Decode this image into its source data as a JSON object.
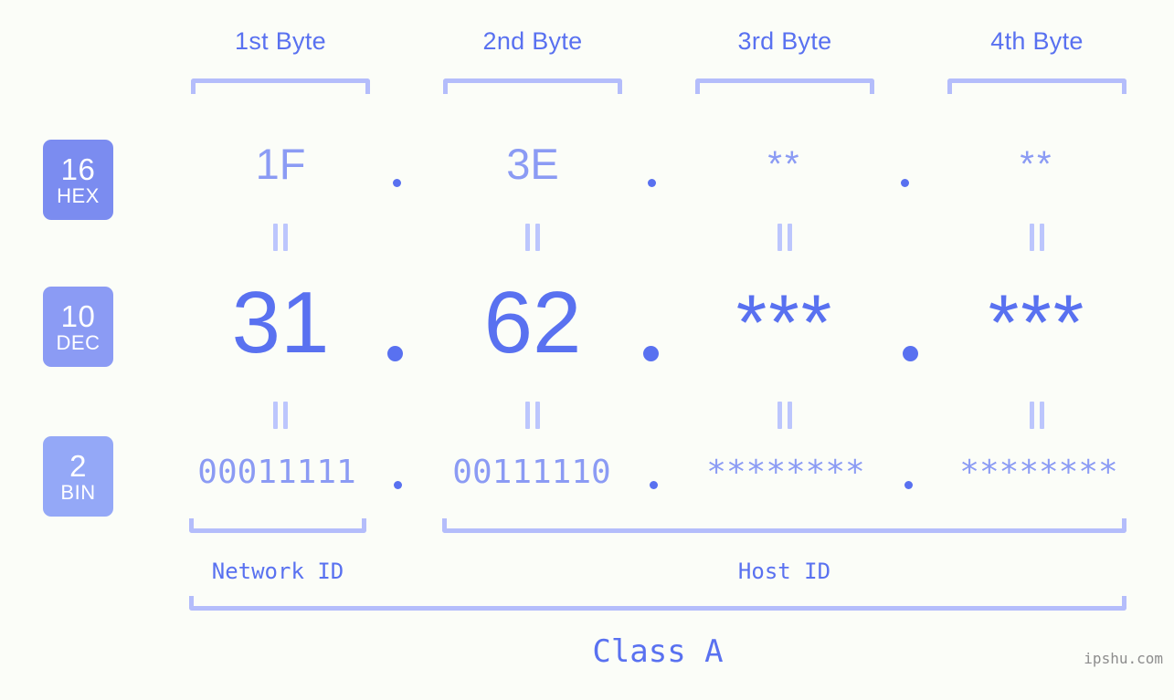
{
  "meta": {
    "background_color": "#fbfdf8",
    "accent_color": "#5971f0",
    "accent_light_color": "#8b9bf4",
    "bracket_color": "#b4bdfb"
  },
  "byte_headers": [
    {
      "label": "1st Byte"
    },
    {
      "label": "2nd Byte"
    },
    {
      "label": "3rd Byte"
    },
    {
      "label": "4th Byte"
    }
  ],
  "bases": [
    {
      "number": "16",
      "name": "HEX",
      "color": "#7b8cf0"
    },
    {
      "number": "10",
      "name": "DEC",
      "color": "#8b9bf4"
    },
    {
      "number": "2",
      "name": "BIN",
      "color": "#94a8f7"
    }
  ],
  "rows": {
    "hex": {
      "values": [
        "1F",
        "3E",
        "**",
        "**"
      ]
    },
    "dec": {
      "values": [
        "31",
        "62",
        "***",
        "***"
      ]
    },
    "bin": {
      "values": [
        "00011111",
        "00111110",
        "********",
        "********"
      ]
    }
  },
  "separators": {
    "hex": [
      ".",
      ".",
      "."
    ],
    "dec": [
      ".",
      ".",
      "."
    ],
    "bin": [
      ".",
      ".",
      "."
    ]
  },
  "equals_marks": {
    "hex_to_dec": [
      "=",
      "=",
      "=",
      "="
    ],
    "dec_to_bin": [
      "=",
      "=",
      "=",
      "="
    ]
  },
  "sections": {
    "network_id": "Network ID",
    "host_id": "Host ID",
    "class": "Class A"
  },
  "watermark": "ipshu.com"
}
